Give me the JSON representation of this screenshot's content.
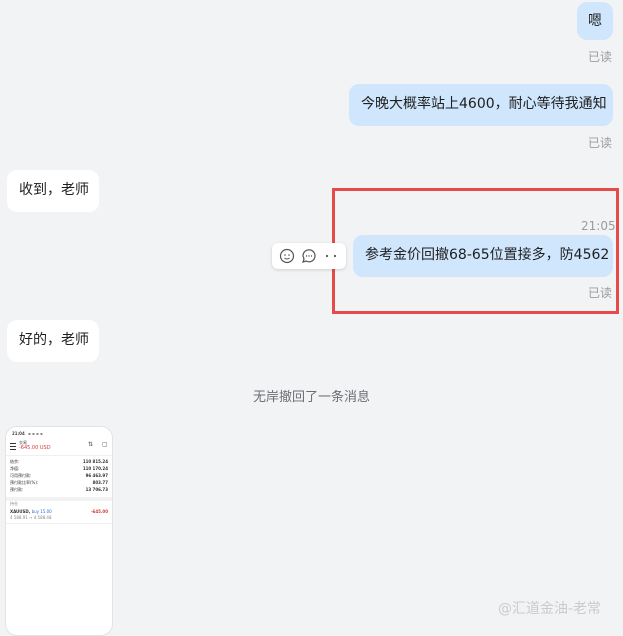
{
  "messages": {
    "m1": {
      "text": "嗯",
      "status": "已读"
    },
    "m2": {
      "text": "今晚大概率站上4600，耐心等待我通知",
      "status": "已读"
    },
    "m3": {
      "text": "收到，老师"
    },
    "m4": {
      "time": "21:05",
      "text": "参考金价回撤68-65位置接多，防4562",
      "status": "已读"
    },
    "m5": {
      "text": "好的，老师"
    },
    "system": "无岸撤回了一条消息"
  },
  "screenshot": {
    "status_time": "21:04",
    "title": "交易",
    "pnl": "-645.00 USD",
    "rows": [
      {
        "label": "结余:",
        "value": "110 815.24"
      },
      {
        "label": "净值:",
        "value": "110 170.24"
      },
      {
        "label": "可用预付款:",
        "value": "96 463.97"
      },
      {
        "label": "预付款比率(%):",
        "value": "803.77"
      },
      {
        "label": "预付款:",
        "value": "13 706.73"
      }
    ],
    "section": "持仓",
    "position_symbol": "XAUUSD,",
    "position_side": "buy 15.00",
    "position_prices": "4 588.91 → 4 588.48",
    "position_pnl": "-645.00"
  },
  "watermark": "@汇道金油-老常",
  "colors": {
    "outgoing": "#cfe6fd",
    "incoming": "#ffffff",
    "highlight": "#e64b4b"
  }
}
